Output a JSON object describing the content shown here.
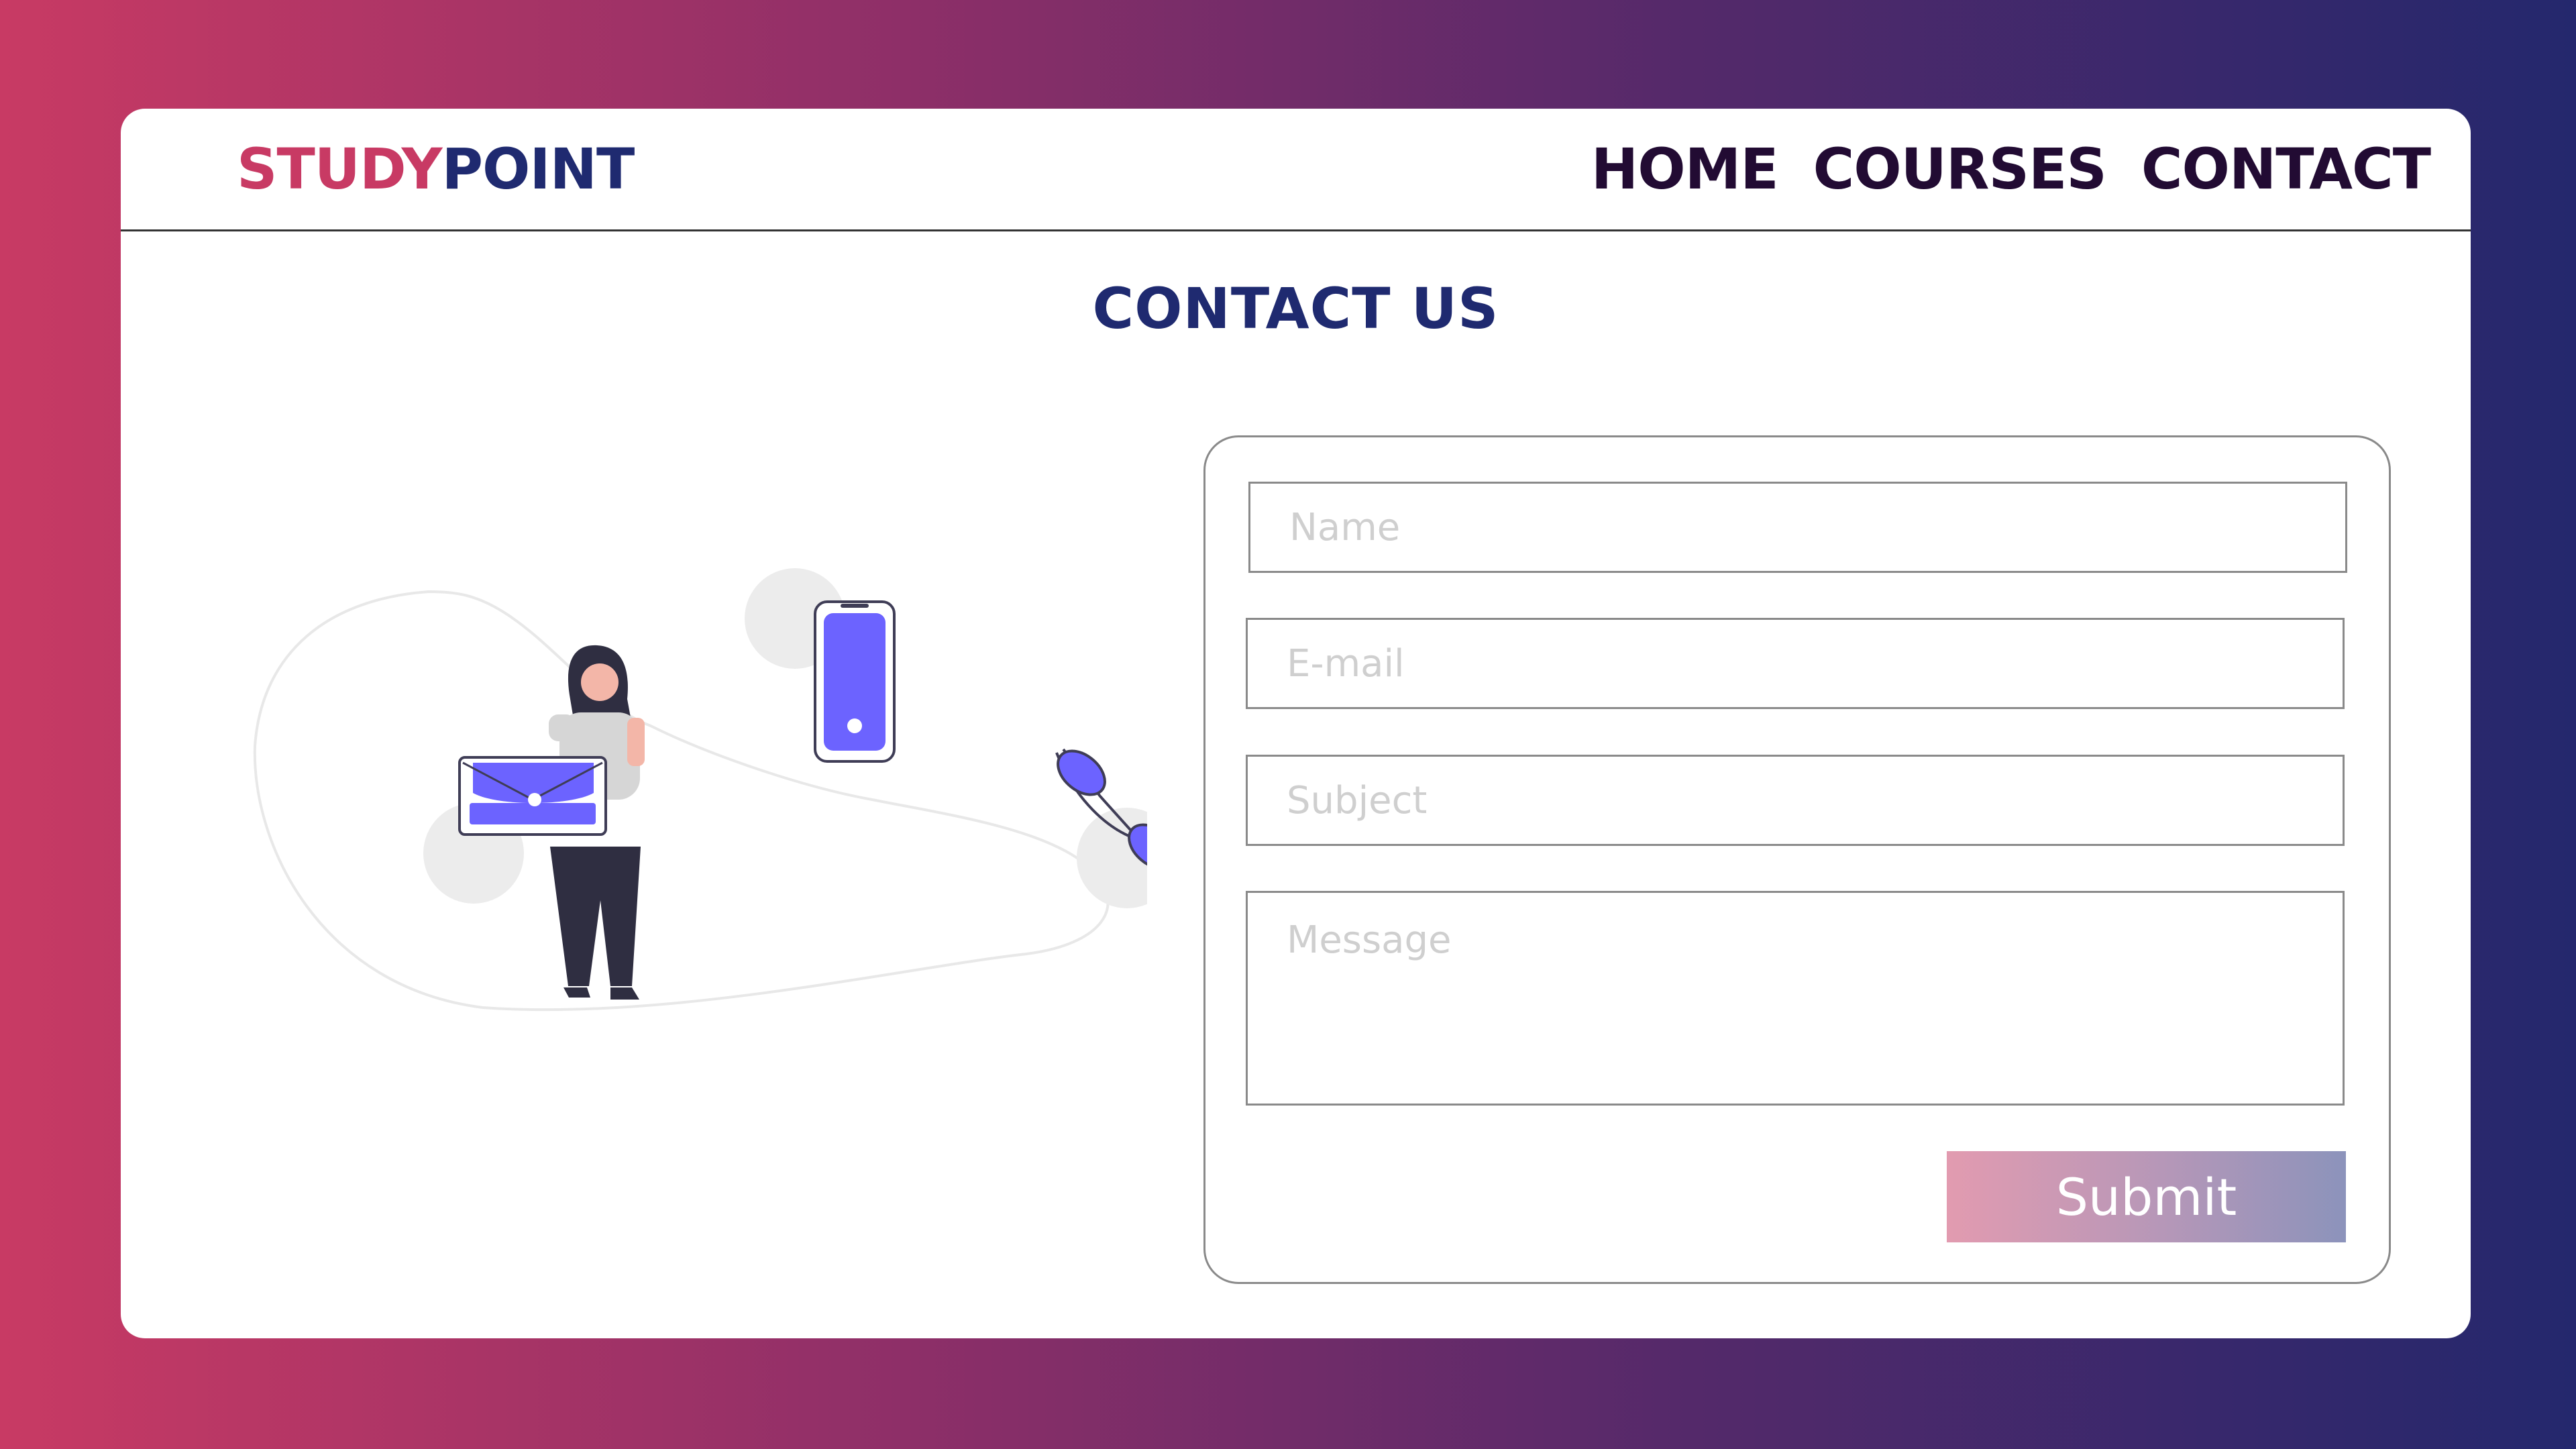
{
  "brand": {
    "part1": "STUDY",
    "part2": "POINT"
  },
  "nav": {
    "home": "HOME",
    "courses": "COURSES",
    "contact": "CONTACT"
  },
  "page": {
    "title": "CONTACT US"
  },
  "form": {
    "name_placeholder": "Name",
    "email_placeholder": "E-mail",
    "subject_placeholder": "Subject",
    "message_placeholder": "Message",
    "submit_label": "Submit"
  },
  "colors": {
    "brand_pink": "#c83a64",
    "brand_navy": "#1f2a70",
    "accent_purple": "#6c63ff",
    "nav_text": "#220b33"
  },
  "illustration": {
    "icons": [
      "person-icon",
      "envelope-icon",
      "smartphone-icon",
      "telephone-handset-icon"
    ]
  }
}
